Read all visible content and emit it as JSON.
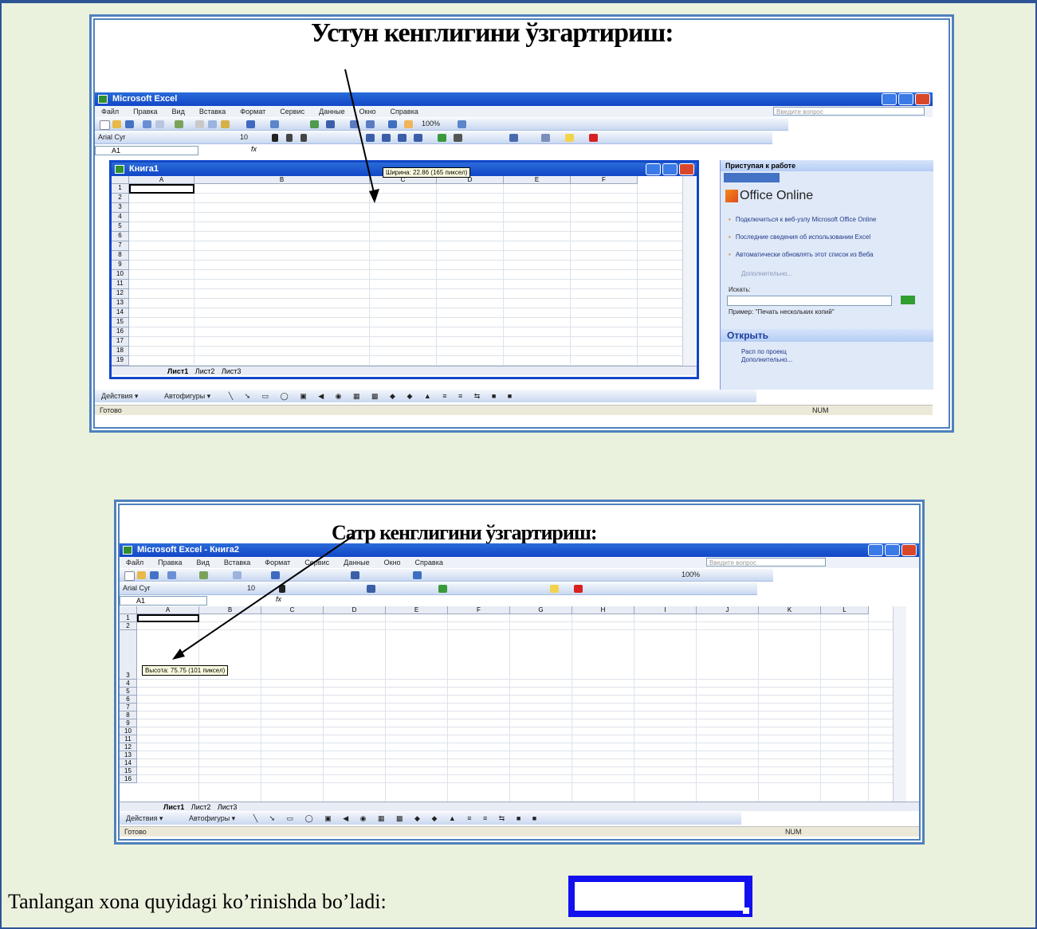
{
  "screenshot1": {
    "caption": "Устун кенглигини ўзгартириш:",
    "title": "Microsoft Excel",
    "menu": [
      "Файл",
      "Правка",
      "Вид",
      "Вставка",
      "Формат",
      "Сервис",
      "Данные",
      "Окно",
      "Справка"
    ],
    "help_placeholder": "Введите вопрос",
    "font_name": "Arial Cyr",
    "font_size": "10",
    "zoom": "100%",
    "name_box": "A1",
    "fx": "fx",
    "workbook_title": "Книга1",
    "tooltip": "Ширина: 22.86 (165 пиксел)",
    "columns": [
      "A",
      "B",
      "C",
      "D",
      "E",
      "F"
    ],
    "rows": [
      "1",
      "2",
      "3",
      "4",
      "5",
      "6",
      "7",
      "8",
      "9",
      "10",
      "11",
      "12",
      "13",
      "14",
      "15",
      "16",
      "17",
      "18",
      "19"
    ],
    "sheet_tabs": [
      "Лист1",
      "Лист2",
      "Лист3"
    ],
    "draw_actions": "Действия ▾",
    "autoshapes": "Автофигуры ▾",
    "status_ready": "Готово",
    "status_num": "NUM",
    "taskpane": {
      "title": "Приступая к работе",
      "office_online": "Office Online",
      "links": [
        "Подключиться к веб-узлу Microsoft Office Online",
        "Последние сведения об использовании Excel",
        "Автоматически обновлять этот список из Веба"
      ],
      "more": "Дополнительно...",
      "search_label": "Искать:",
      "example": "Пример: \"Печать нескольких копий\"",
      "open_header": "Открыть",
      "open_items": [
        "Расп по проекц",
        "Дополнительно..."
      ]
    }
  },
  "screenshot2": {
    "caption": "Сатр кенглигини ўзгартириш:",
    "title": "Microsoft Excel - Книга2",
    "menu": [
      "Файл",
      "Правка",
      "Вид",
      "Вставка",
      "Формат",
      "Сервис",
      "Данные",
      "Окно",
      "Справка"
    ],
    "help_placeholder": "Введите вопрос",
    "font_name": "Arial Cyr",
    "font_size": "10",
    "zoom": "100%",
    "name_box": "A1",
    "fx": "fx",
    "tooltip": "Высота: 75.75 (101 пиксел)",
    "columns": [
      "A",
      "B",
      "C",
      "D",
      "E",
      "F",
      "G",
      "H",
      "I",
      "J",
      "K",
      "L"
    ],
    "rows": [
      "1",
      "2",
      "3",
      "4",
      "5",
      "6",
      "7",
      "8",
      "9",
      "10",
      "11",
      "12",
      "13",
      "14",
      "15",
      "16"
    ],
    "sheet_tabs": [
      "Лист1",
      "Лист2",
      "Лист3"
    ],
    "draw_actions": "Действия ▾",
    "autoshapes": "Автофигуры ▾",
    "status_ready": "Готово",
    "status_num": "NUM"
  },
  "bottom_text": "Tanlangan xona quyidagi ko’rinishda bo’ladi:",
  "colors": {
    "page_bg": "#eaf1dd",
    "frame": "#4f81bd",
    "excel_blue": "#1146c8",
    "selection_sample": "#1210ee"
  }
}
